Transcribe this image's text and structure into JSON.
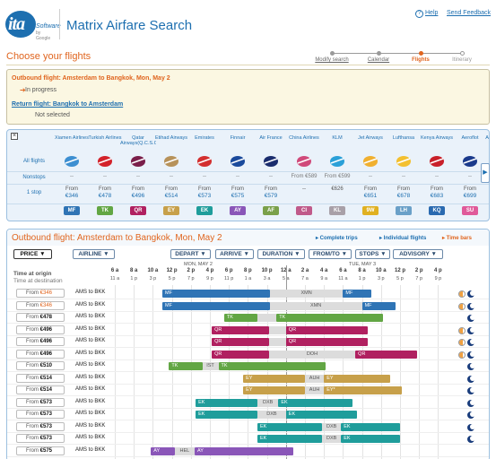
{
  "header": {
    "logo_text": "ita",
    "logo_sub": "Software",
    "logo_sub2": "by Google",
    "app_title": "Matrix Airfare Search",
    "help": "Help",
    "feedback": "Send Feedback"
  },
  "progress": {
    "steps": [
      {
        "label": "Modify search",
        "state": "link"
      },
      {
        "label": "Calendar",
        "state": "link"
      },
      {
        "label": "Flights",
        "state": "active"
      },
      {
        "label": "Itinerary",
        "state": "future"
      }
    ]
  },
  "page_heading": "Choose your flights",
  "summary": {
    "outbound_title": "Outbound flight: Amsterdam to Bangkok, Mon, May 2",
    "outbound_status": "In progress",
    "return_title": "Return flight: Bangkok to Amsterdam",
    "return_status": "Not selected"
  },
  "matrix": {
    "close": "×",
    "row_labels": {
      "all": "All flights",
      "nonstops": "Nonstops",
      "onestop": "1 stop"
    },
    "next": "▶",
    "airlines": [
      {
        "name": "Xiamen Airlines",
        "nonstop": "--",
        "from": "From",
        "price": "€346",
        "code": "MF",
        "color": "#2f74b5",
        "logo": "#3d8fd1"
      },
      {
        "name": "Turkish Airlines",
        "nonstop": "--",
        "from": "From",
        "price": "€478",
        "code": "TK",
        "color": "#62a644",
        "logo": "#d3222a"
      },
      {
        "name": "Qatar Airways(Q.C.S.C)",
        "nonstop": "--",
        "from": "From",
        "price": "€496",
        "code": "QR",
        "color": "#b02060",
        "logo": "#7a1f4a"
      },
      {
        "name": "Etihad Airways",
        "nonstop": "--",
        "from": "From",
        "price": "€514",
        "code": "EY",
        "color": "#c7a04a",
        "logo": "#b7925a"
      },
      {
        "name": "Emirates",
        "nonstop": "--",
        "from": "From",
        "price": "€573",
        "code": "EK",
        "color": "#1f9d9b",
        "logo": "#d32f2f"
      },
      {
        "name": "Finnair",
        "nonstop": "--",
        "from": "From",
        "price": "€575",
        "code": "AY",
        "color": "#8a56b8",
        "logo": "#1a4a9c"
      },
      {
        "name": "Air France",
        "nonstop": "--",
        "from": "From",
        "price": "€579",
        "code": "AF",
        "color": "#7aa04a",
        "logo": "#1a2d6e"
      },
      {
        "name": "China Airlines",
        "nonstop": "From €589",
        "from": "",
        "price": "--",
        "code": "CI",
        "color": "#c05a8a",
        "logo": "#d04a7a"
      },
      {
        "name": "KLM",
        "nonstop": "From €599",
        "from": "",
        "price": "€626",
        "code": "KL",
        "color": "#a8a0a8",
        "logo": "#2aa0d8"
      },
      {
        "name": "Jet Airways",
        "nonstop": "--",
        "from": "From",
        "price": "€651",
        "code": "9W",
        "color": "#e0b020",
        "logo": "#f0b030"
      },
      {
        "name": "Lufthansa",
        "nonstop": "--",
        "from": "From",
        "price": "€678",
        "code": "LH",
        "color": "#6aa0c8",
        "logo": "#f3c030"
      },
      {
        "name": "Kenya Airways",
        "nonstop": "--",
        "from": "From",
        "price": "€683",
        "code": "KQ",
        "color": "#2a6ab0",
        "logo": "#c8202a"
      },
      {
        "name": "Aeroflot",
        "nonstop": "--",
        "from": "From",
        "price": "€699",
        "code": "SU",
        "color": "#e05a9a",
        "logo": "#1a3a8c"
      },
      {
        "name": "Austrian Airlines",
        "nonstop": "--",
        "from": "From",
        "price": "€73",
        "code": "OS",
        "color": "#e0904a",
        "logo": "#d02a2a"
      }
    ]
  },
  "results": {
    "title": "Outbound flight: Amsterdam to Bangkok, Mon, May 2",
    "views": {
      "complete": "▸ Complete trips",
      "individual": "▸ Individual flights",
      "timebars": "▸ Time bars"
    },
    "sort": [
      {
        "label": "PRICE ▼",
        "key": "price"
      },
      {
        "label": "AIRLINE ▼",
        "key": "airline"
      },
      {
        "label": "DEPART ▼",
        "key": "depart"
      },
      {
        "label": "ARRIVE ▼",
        "key": "arrive"
      },
      {
        "label": "DURATION ▼",
        "key": "duration"
      },
      {
        "label": "FROM/TO ▼",
        "key": "fromto"
      },
      {
        "label": "STOPS ▼",
        "key": "stops"
      },
      {
        "label": "ADVISORY ▼",
        "key": "advisory"
      }
    ],
    "time_at_origin": "Time at origin",
    "time_at_dest": "Time at destination",
    "day1": "MON, MAY 2",
    "day2": "TUE, MAY 3",
    "ticks_top": [
      "6 a",
      "8 a",
      "10 a",
      "12 p",
      "2 p",
      "4 p",
      "6 p",
      "8 p",
      "10 p",
      "12 a",
      "2 a",
      "4 a",
      "6 a",
      "8 a",
      "10 a",
      "12 p",
      "2 p",
      "4 p"
    ],
    "ticks_bot": [
      "11 a",
      "1 p",
      "3 p",
      "5 p",
      "7 p",
      "9 p",
      "11 p",
      "1 a",
      "3 a",
      "5 a",
      "7 a",
      "9 a",
      "11 a",
      "1 p",
      "3 p",
      "5 p",
      "7 p",
      "9 p"
    ],
    "rows": [
      {
        "price": "€346",
        "from": "From",
        "style": "orange",
        "route": "AMS to BKK",
        "segs": [
          {
            "c": "MF",
            "s": 11.0,
            "e": 22.3,
            "col": "#2f74b5"
          },
          {
            "c": "XMN",
            "s": 22.3,
            "e": 30.0,
            "lay": true
          },
          {
            "c": "MF",
            "s": 30.0,
            "e": 33.0,
            "col": "#2f74b5"
          }
        ],
        "icons": [
          "day",
          "night"
        ]
      },
      {
        "price": "€346",
        "from": "From",
        "style": "orange",
        "route": "AMS to BKK",
        "segs": [
          {
            "c": "MF",
            "s": 11.0,
            "e": 22.3,
            "col": "#2f74b5"
          },
          {
            "c": "XMN",
            "s": 22.3,
            "e": 32.0,
            "lay": true
          },
          {
            "c": "MF",
            "s": 32.0,
            "e": 35.5,
            "col": "#2f74b5"
          }
        ],
        "icons": [
          "day",
          "night"
        ]
      },
      {
        "price": "€478",
        "from": "From",
        "style": "black",
        "route": "AMS to BKK",
        "segs": [
          {
            "c": "TK",
            "s": 17.5,
            "e": 21.0,
            "col": "#62a644"
          },
          {
            "c": "",
            "s": 21.0,
            "e": 23.0,
            "lay": true
          },
          {
            "c": "TK",
            "s": 23.0,
            "e": 34.2,
            "col": "#62a644"
          }
        ],
        "icons": [
          "night"
        ]
      },
      {
        "price": "€496",
        "from": "From",
        "style": "black",
        "route": "AMS to BKK",
        "segs": [
          {
            "c": "QR",
            "s": 16.2,
            "e": 22.2,
            "col": "#b02060"
          },
          {
            "c": "",
            "s": 22.2,
            "e": 24.0,
            "lay": true
          },
          {
            "c": "QR",
            "s": 24.0,
            "e": 32.6,
            "col": "#b02060"
          }
        ],
        "icons": [
          "day",
          "night"
        ]
      },
      {
        "price": "€496",
        "from": "From",
        "style": "black",
        "route": "AMS to BKK",
        "segs": [
          {
            "c": "QR",
            "s": 16.2,
            "e": 22.2,
            "col": "#b02060"
          },
          {
            "c": "",
            "s": 22.2,
            "e": 24.0,
            "lay": true
          },
          {
            "c": "QR",
            "s": 24.0,
            "e": 32.6,
            "col": "#b02060"
          }
        ],
        "icons": [
          "day",
          "night"
        ]
      },
      {
        "price": "€496",
        "from": "From",
        "style": "black",
        "route": "AMS to BKK",
        "segs": [
          {
            "c": "QR",
            "s": 16.2,
            "e": 22.2,
            "col": "#b02060"
          },
          {
            "c": "DOH",
            "s": 22.2,
            "e": 31.3,
            "lay": true
          },
          {
            "c": "QR",
            "s": 31.3,
            "e": 37.8,
            "col": "#b02060"
          }
        ],
        "icons": [
          "day",
          "night"
        ]
      },
      {
        "price": "€510",
        "from": "From",
        "style": "black",
        "route": "AMS to BKK",
        "segs": [
          {
            "c": "TK",
            "s": 11.7,
            "e": 15.2,
            "col": "#62a644"
          },
          {
            "c": "IST",
            "s": 15.2,
            "e": 16.9,
            "lay": true
          },
          {
            "c": "TK",
            "s": 16.9,
            "e": 28.2,
            "col": "#62a644"
          }
        ],
        "icons": [
          "night"
        ]
      },
      {
        "price": "€514",
        "from": "From",
        "style": "black",
        "route": "AMS to BKK",
        "segs": [
          {
            "c": "EY",
            "s": 19.5,
            "e": 26.0,
            "col": "#c7a04a"
          },
          {
            "c": "AUH",
            "s": 26.0,
            "e": 28.0,
            "lay": true
          },
          {
            "c": "EY",
            "s": 28.0,
            "e": 35.0,
            "col": "#c7a04a"
          }
        ],
        "icons": [
          "night"
        ]
      },
      {
        "price": "€514",
        "from": "From",
        "style": "black",
        "route": "AMS to BKK",
        "segs": [
          {
            "c": "EY",
            "s": 19.5,
            "e": 26.0,
            "col": "#c7a04a"
          },
          {
            "c": "AUH",
            "s": 26.0,
            "e": 28.0,
            "lay": true
          },
          {
            "c": "EY*",
            "s": 28.0,
            "e": 36.2,
            "col": "#c7a04a"
          }
        ],
        "icons": [
          "night"
        ]
      },
      {
        "price": "€573",
        "from": "From",
        "style": "black",
        "route": "AMS to BKK",
        "segs": [
          {
            "c": "EK",
            "s": 14.5,
            "e": 21.0,
            "col": "#1f9d9b"
          },
          {
            "c": "DXB",
            "s": 21.0,
            "e": 23.2,
            "lay": true
          },
          {
            "c": "EK",
            "s": 23.2,
            "e": 31.0,
            "col": "#1f9d9b"
          }
        ],
        "icons": [
          "night"
        ]
      },
      {
        "price": "€573",
        "from": "From",
        "style": "black",
        "route": "AMS to BKK",
        "segs": [
          {
            "c": "EK",
            "s": 14.5,
            "e": 21.0,
            "col": "#1f9d9b"
          },
          {
            "c": "DXB",
            "s": 21.0,
            "e": 24.0,
            "lay": true
          },
          {
            "c": "EK",
            "s": 24.0,
            "e": 31.5,
            "col": "#1f9d9b"
          }
        ],
        "icons": [
          "night"
        ]
      },
      {
        "price": "€573",
        "from": "From",
        "style": "black",
        "route": "AMS to BKK",
        "segs": [
          {
            "c": "EK",
            "s": 21.0,
            "e": 27.8,
            "col": "#1f9d9b"
          },
          {
            "c": "DXB",
            "s": 27.8,
            "e": 29.8,
            "lay": true
          },
          {
            "c": "EK",
            "s": 29.8,
            "e": 36.0,
            "col": "#1f9d9b"
          }
        ],
        "icons": [
          "night"
        ]
      },
      {
        "price": "€573",
        "from": "From",
        "style": "black",
        "route": "AMS to BKK",
        "segs": [
          {
            "c": "EK",
            "s": 21.0,
            "e": 27.8,
            "col": "#1f9d9b"
          },
          {
            "c": "DXB",
            "s": 27.8,
            "e": 29.8,
            "lay": true
          },
          {
            "c": "EK",
            "s": 29.8,
            "e": 36.0,
            "col": "#1f9d9b"
          }
        ],
        "icons": [
          "night"
        ]
      },
      {
        "price": "€575",
        "from": "From",
        "style": "black",
        "route": "AMS to BKK",
        "segs": [
          {
            "c": "AY",
            "s": 9.8,
            "e": 12.3,
            "col": "#8a56b8"
          },
          {
            "c": "HEL",
            "s": 12.3,
            "e": 14.4,
            "lay": true
          },
          {
            "c": "AY",
            "s": 14.4,
            "e": 24.8,
            "col": "#8a56b8"
          }
        ],
        "icons": []
      }
    ]
  }
}
